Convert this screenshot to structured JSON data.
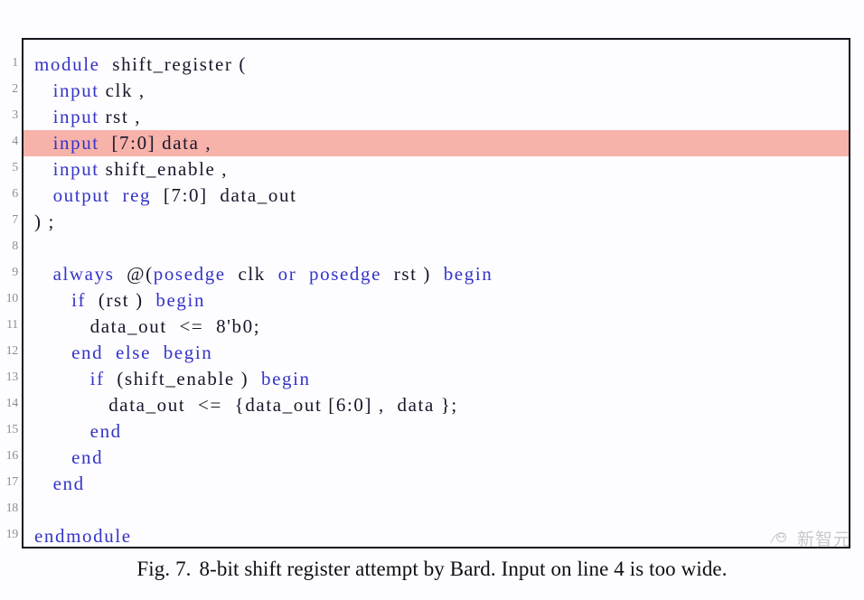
{
  "figure": {
    "caption_label": "Fig. 7.",
    "caption_text": "8-bit shift register attempt by Bard. Input on line 4 is too wide.",
    "highlighted_line_number": 4,
    "highlight_color": "#f7b2aa",
    "keyword_color": "#3434c8",
    "identifier_color": "#16162b",
    "gutter_color": "#8d8d9b",
    "border_color": "#15151f",
    "background_color": "#fdfdff"
  },
  "gutter": {
    "line_numbers": [
      1,
      2,
      3,
      4,
      5,
      6,
      7,
      8,
      9,
      10,
      11,
      12,
      13,
      14,
      15,
      16,
      17,
      18,
      19
    ]
  },
  "code": {
    "language": "verilog",
    "lines": [
      {
        "n": 1,
        "highlight": false,
        "text": "module  shift_register (",
        "tokens": [
          {
            "t": "module",
            "c": "kw"
          },
          {
            "t": "  ",
            "c": "punc"
          },
          {
            "t": "shift_register",
            "c": "id"
          },
          {
            "t": " (",
            "c": "punc"
          }
        ]
      },
      {
        "n": 2,
        "highlight": false,
        "text": "   input clk ,",
        "tokens": [
          {
            "t": "   ",
            "c": "punc"
          },
          {
            "t": "input",
            "c": "kw"
          },
          {
            "t": " ",
            "c": "punc"
          },
          {
            "t": "clk ,",
            "c": "id"
          }
        ]
      },
      {
        "n": 3,
        "highlight": false,
        "text": "   input rst ,",
        "tokens": [
          {
            "t": "   ",
            "c": "punc"
          },
          {
            "t": "input",
            "c": "kw"
          },
          {
            "t": " ",
            "c": "punc"
          },
          {
            "t": "rst ,",
            "c": "id"
          }
        ]
      },
      {
        "n": 4,
        "highlight": true,
        "text": "   input  [7:0] data ,",
        "tokens": [
          {
            "t": "   ",
            "c": "punc"
          },
          {
            "t": "input",
            "c": "kw"
          },
          {
            "t": "  ",
            "c": "punc"
          },
          {
            "t": "[7:0] data ,",
            "c": "id"
          }
        ]
      },
      {
        "n": 5,
        "highlight": false,
        "text": "   input shift_enable ,",
        "tokens": [
          {
            "t": "   ",
            "c": "punc"
          },
          {
            "t": "input",
            "c": "kw"
          },
          {
            "t": " ",
            "c": "punc"
          },
          {
            "t": "shift_enable ,",
            "c": "id"
          }
        ]
      },
      {
        "n": 6,
        "highlight": false,
        "text": "   output  reg  [7:0]  data_out",
        "tokens": [
          {
            "t": "   ",
            "c": "punc"
          },
          {
            "t": "output",
            "c": "kw"
          },
          {
            "t": "  ",
            "c": "punc"
          },
          {
            "t": "reg",
            "c": "kw"
          },
          {
            "t": "  ",
            "c": "punc"
          },
          {
            "t": "[7:0]  data_out",
            "c": "id"
          }
        ]
      },
      {
        "n": 7,
        "highlight": false,
        "text": ") ;",
        "tokens": [
          {
            "t": ") ;",
            "c": "punc"
          }
        ]
      },
      {
        "n": 8,
        "highlight": false,
        "text": "",
        "tokens": []
      },
      {
        "n": 9,
        "highlight": false,
        "text": "   always  @(posedge  clk  or  posedge  rst )  begin",
        "tokens": [
          {
            "t": "   ",
            "c": "punc"
          },
          {
            "t": "always",
            "c": "kw"
          },
          {
            "t": "  @(",
            "c": "punc"
          },
          {
            "t": "posedge",
            "c": "kw"
          },
          {
            "t": "  ",
            "c": "punc"
          },
          {
            "t": "clk",
            "c": "id"
          },
          {
            "t": "  ",
            "c": "punc"
          },
          {
            "t": "or",
            "c": "kw"
          },
          {
            "t": "  ",
            "c": "punc"
          },
          {
            "t": "posedge",
            "c": "kw"
          },
          {
            "t": "  ",
            "c": "punc"
          },
          {
            "t": "rst",
            "c": "id"
          },
          {
            "t": " )  ",
            "c": "punc"
          },
          {
            "t": "begin",
            "c": "kw"
          }
        ]
      },
      {
        "n": 10,
        "highlight": false,
        "text": "      if  (rst )  begin",
        "tokens": [
          {
            "t": "      ",
            "c": "punc"
          },
          {
            "t": "if",
            "c": "kw"
          },
          {
            "t": "  (",
            "c": "punc"
          },
          {
            "t": "rst",
            "c": "id"
          },
          {
            "t": " )  ",
            "c": "punc"
          },
          {
            "t": "begin",
            "c": "kw"
          }
        ]
      },
      {
        "n": 11,
        "highlight": false,
        "text": "         data_out  <=  8'b0;",
        "tokens": [
          {
            "t": "         ",
            "c": "punc"
          },
          {
            "t": "data_out",
            "c": "id"
          },
          {
            "t": "  ",
            "c": "punc"
          },
          {
            "t": "<=",
            "c": "op"
          },
          {
            "t": "  ",
            "c": "punc"
          },
          {
            "t": "8'b0;",
            "c": "num"
          }
        ]
      },
      {
        "n": 12,
        "highlight": false,
        "text": "      end  else  begin",
        "tokens": [
          {
            "t": "      ",
            "c": "punc"
          },
          {
            "t": "end",
            "c": "kw"
          },
          {
            "t": "  ",
            "c": "punc"
          },
          {
            "t": "else",
            "c": "kw"
          },
          {
            "t": "  ",
            "c": "punc"
          },
          {
            "t": "begin",
            "c": "kw"
          }
        ]
      },
      {
        "n": 13,
        "highlight": false,
        "text": "         if  (shift_enable )  begin",
        "tokens": [
          {
            "t": "         ",
            "c": "punc"
          },
          {
            "t": "if",
            "c": "kw"
          },
          {
            "t": "  (",
            "c": "punc"
          },
          {
            "t": "shift_enable",
            "c": "id"
          },
          {
            "t": " )  ",
            "c": "punc"
          },
          {
            "t": "begin",
            "c": "kw"
          }
        ]
      },
      {
        "n": 14,
        "highlight": false,
        "text": "            data_out  <=  {data_out [6:0] ,  data };",
        "tokens": [
          {
            "t": "            ",
            "c": "punc"
          },
          {
            "t": "data_out",
            "c": "id"
          },
          {
            "t": "  ",
            "c": "punc"
          },
          {
            "t": "<=",
            "c": "op"
          },
          {
            "t": "  {",
            "c": "punc"
          },
          {
            "t": "data_out [6:0] ,  data",
            "c": "id"
          },
          {
            "t": " };",
            "c": "punc"
          }
        ]
      },
      {
        "n": 15,
        "highlight": false,
        "text": "         end",
        "tokens": [
          {
            "t": "         ",
            "c": "punc"
          },
          {
            "t": "end",
            "c": "kw"
          }
        ]
      },
      {
        "n": 16,
        "highlight": false,
        "text": "      end",
        "tokens": [
          {
            "t": "      ",
            "c": "punc"
          },
          {
            "t": "end",
            "c": "kw"
          }
        ]
      },
      {
        "n": 17,
        "highlight": false,
        "text": "   end",
        "tokens": [
          {
            "t": "   ",
            "c": "punc"
          },
          {
            "t": "end",
            "c": "kw"
          }
        ]
      },
      {
        "n": 18,
        "highlight": false,
        "text": "",
        "tokens": []
      },
      {
        "n": 19,
        "highlight": false,
        "text": "endmodule",
        "tokens": [
          {
            "t": "endmodule",
            "c": "kw"
          }
        ]
      }
    ]
  },
  "watermark": {
    "text": "新智元",
    "icon": "owl-logo-mark"
  }
}
